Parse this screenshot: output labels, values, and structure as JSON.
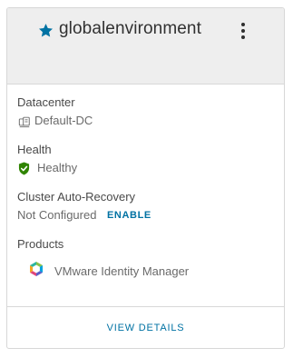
{
  "card": {
    "title": "globalenvironment",
    "favorite_icon": "star-icon",
    "menu_icon": "vertical-ellipsis-icon"
  },
  "datacenter": {
    "label": "Datacenter",
    "value": "Default-DC",
    "icon": "datacenter-icon"
  },
  "health": {
    "label": "Health",
    "value": "Healthy",
    "icon": "shield-check-icon",
    "status_color": "#2f8400"
  },
  "cluster_auto_recovery": {
    "label": "Cluster Auto-Recovery",
    "value": "Not Configured",
    "action_label": "ENABLE"
  },
  "products": {
    "label": "Products",
    "items": [
      {
        "name": "VMware Identity Manager",
        "icon": "identity-manager-icon"
      }
    ]
  },
  "footer": {
    "view_details_label": "VIEW DETAILS"
  },
  "colors": {
    "accent": "#0072a3",
    "star": "#0072a3",
    "header_bg": "#eeeeee"
  }
}
